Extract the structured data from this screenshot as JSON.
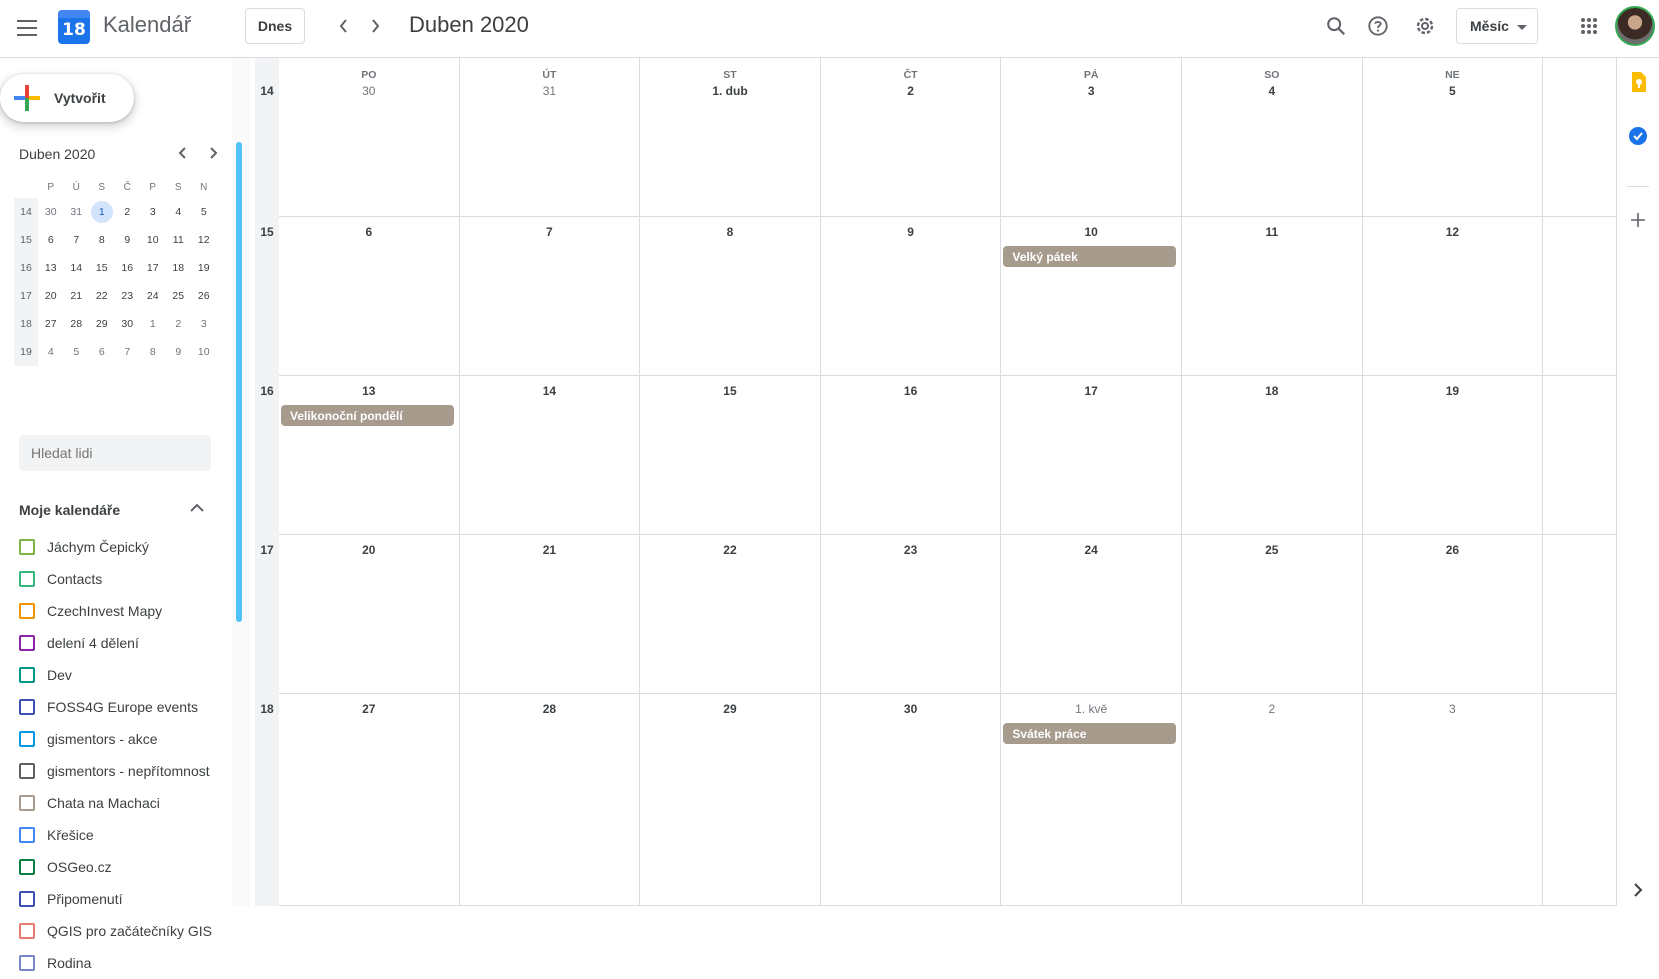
{
  "app": {
    "title": "Kalendář",
    "logo_day": "18"
  },
  "toolbar": {
    "today_label": "Dnes",
    "prev": "‹",
    "next": "›",
    "month_title": "Duben 2020",
    "view_label": "Měsíc"
  },
  "icons": {
    "menu": "menu-icon",
    "search": "search-icon",
    "help": "help-icon",
    "settings": "gear-icon",
    "apps": "apps-grid-icon",
    "account": "avatar"
  },
  "sidebar": {
    "create_label": "Vytvořit",
    "mini": {
      "title": "Duben 2020",
      "dow": [
        "P",
        "Ú",
        "S",
        "Č",
        "P",
        "S",
        "N"
      ],
      "weeks": [
        {
          "wk": "14",
          "days": [
            "30",
            "31",
            "1",
            "2",
            "3",
            "4",
            "5"
          ]
        },
        {
          "wk": "15",
          "days": [
            "6",
            "7",
            "8",
            "9",
            "10",
            "11",
            "12"
          ]
        },
        {
          "wk": "16",
          "days": [
            "13",
            "14",
            "15",
            "16",
            "17",
            "18",
            "19"
          ]
        },
        {
          "wk": "17",
          "days": [
            "20",
            "21",
            "22",
            "23",
            "24",
            "25",
            "26"
          ]
        },
        {
          "wk": "18",
          "days": [
            "27",
            "28",
            "29",
            "30",
            "1",
            "2",
            "3"
          ]
        },
        {
          "wk": "19",
          "days": [
            "4",
            "5",
            "6",
            "7",
            "8",
            "9",
            "10"
          ]
        }
      ]
    },
    "search_placeholder": "Hledat lidi",
    "my_calendars_label": "Moje kalendáře",
    "calendars": [
      {
        "name": "Jáchym Čepický",
        "color": "#7cb342"
      },
      {
        "name": "Contacts",
        "color": "#33b679"
      },
      {
        "name": "CzechInvest Mapy",
        "color": "#f09300"
      },
      {
        "name": "delení 4 dělení",
        "color": "#8e24aa"
      },
      {
        "name": "Dev",
        "color": "#009688"
      },
      {
        "name": "FOSS4G Europe events",
        "color": "#3f51b5"
      },
      {
        "name": "gismentors - akce",
        "color": "#039be5"
      },
      {
        "name": "gismentors - nepřítomnost",
        "color": "#616161"
      },
      {
        "name": "Chata na Machaci",
        "color": "#a79b8e"
      },
      {
        "name": "Křešice",
        "color": "#4285f4"
      },
      {
        "name": "OSGeo.cz",
        "color": "#0b8043"
      },
      {
        "name": "Připomenutí",
        "color": "#3f51b5"
      },
      {
        "name": "QGIS pro začátečníky GIS",
        "color": "#e67c73"
      },
      {
        "name": "Rodina",
        "color": "#7986cb"
      }
    ]
  },
  "month": {
    "dow": [
      "PO",
      "ÚT",
      "ST",
      "ČT",
      "PÁ",
      "SO",
      "NE"
    ],
    "weeks": [
      {
        "wk": "14",
        "days": [
          "30",
          "31",
          "1. dub",
          "2",
          "3",
          "4",
          "5"
        ]
      },
      {
        "wk": "15",
        "days": [
          "6",
          "7",
          "8",
          "9",
          "10",
          "11",
          "12"
        ]
      },
      {
        "wk": "16",
        "days": [
          "13",
          "14",
          "15",
          "16",
          "17",
          "18",
          "19"
        ]
      },
      {
        "wk": "17",
        "days": [
          "20",
          "21",
          "22",
          "23",
          "24",
          "25",
          "26"
        ]
      },
      {
        "wk": "18",
        "days": [
          "27",
          "28",
          "29",
          "30",
          "1. kvě",
          "2",
          "3"
        ]
      }
    ],
    "events": {
      "velky_patek": "Velký pátek",
      "velikonocni_pondeli": "Velikonoční pondělí",
      "svatek_prace": "Svátek práce"
    },
    "event_color": "#a79b8e"
  }
}
